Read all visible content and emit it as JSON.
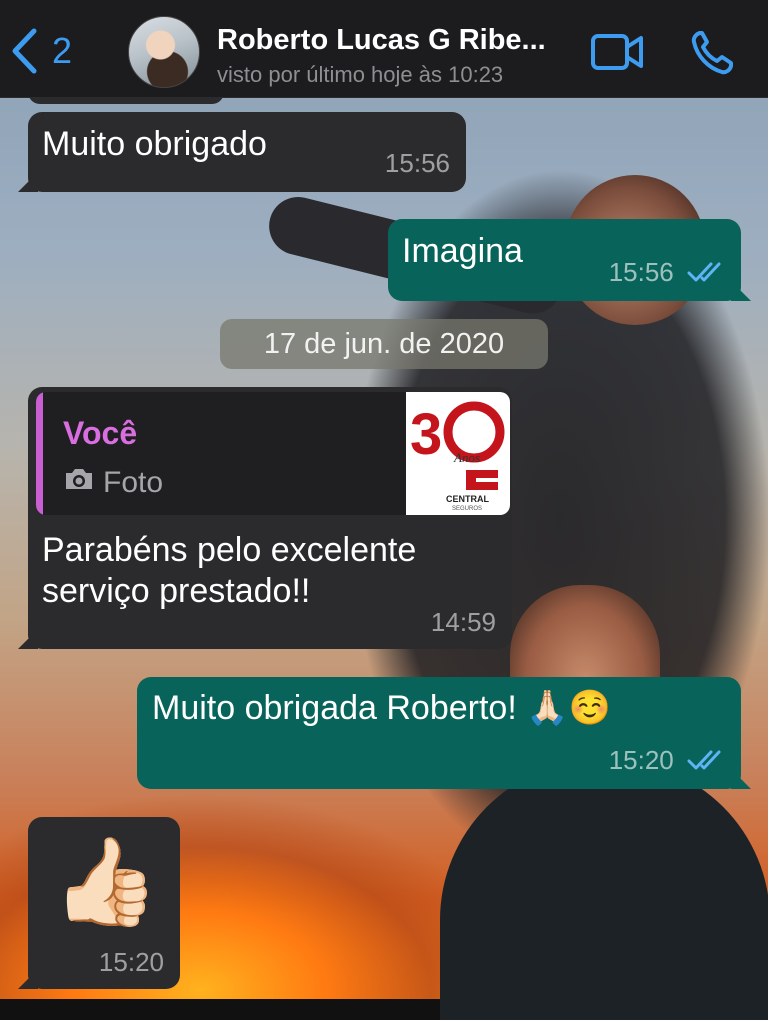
{
  "header": {
    "back_count": "2",
    "contact_name": "Roberto Lucas G Ribe...",
    "last_seen": "visto por último hoje às 10:23",
    "accent_color": "#3d9cf0"
  },
  "messages": [
    {
      "text": "Muito obrigado",
      "time": "15:56",
      "direction": "incoming"
    },
    {
      "text": "Imagina",
      "time": "15:56",
      "direction": "outgoing",
      "status": "read"
    },
    {
      "text": "Parabéns pelo excelente serviço prestado!!",
      "time": "14:59",
      "direction": "incoming",
      "reply": {
        "author": "Você",
        "kind": "Foto"
      }
    },
    {
      "text": "Muito obrigada Roberto! 🙏🏻☺️",
      "time": "15:20",
      "direction": "outgoing",
      "status": "read"
    },
    {
      "text": "👍🏻",
      "time": "15:20",
      "direction": "incoming"
    }
  ],
  "date_separator": "17 de jun. de 2020",
  "thumbnail": {
    "brand_text": "CENTRAL",
    "brand_sub": "SEGUROS",
    "number": "30",
    "anos": "Anos"
  },
  "icons": [
    "chevron-left-icon",
    "video-call-icon",
    "phone-icon",
    "camera-icon",
    "double-check-icon"
  ]
}
